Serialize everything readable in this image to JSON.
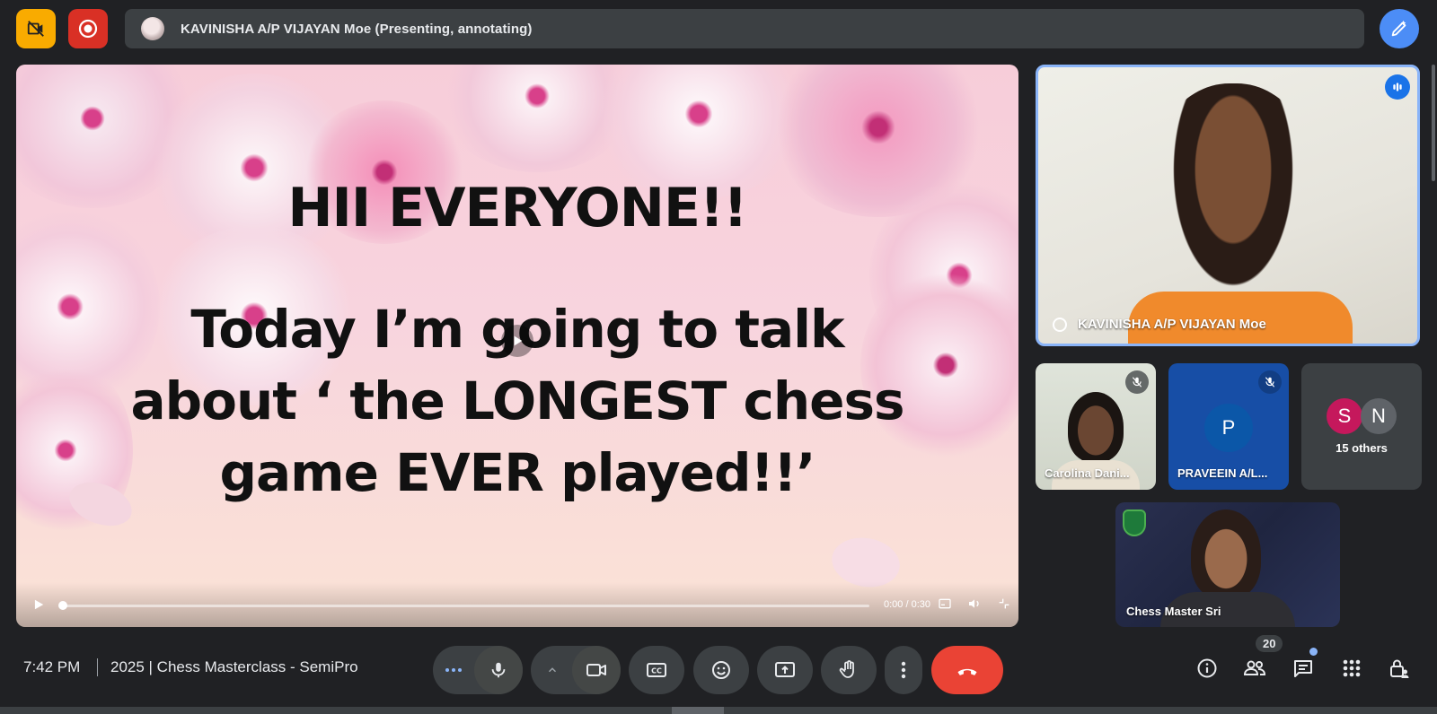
{
  "topbar": {
    "presenter_status": "KAVINISHA A/P VIJAYAN Moe (Presenting, annotating)",
    "icons": [
      "no-video-icon",
      "record-icon",
      "pen-edit-icon"
    ],
    "colors": {
      "camera_off_button": "#f9ab00",
      "record_button": "#d93025",
      "annotate_button": "#4c8df6"
    }
  },
  "slide": {
    "heading": "HII EVERYONE!!",
    "body_line1": "Today I’m going to talk",
    "body_line2": "about ‘ the LONGEST chess",
    "body_line3": "game EVER played!!’"
  },
  "video": {
    "time": "0:00 / 0:30",
    "progress": 0
  },
  "participants": {
    "main": {
      "name": "KAVINISHA A/P VIJAYAN Moe"
    },
    "carolina": {
      "name": "Carolina Dani..."
    },
    "praveein": {
      "name": "PRAVEEIN A/L...",
      "initial": "P"
    },
    "others": {
      "initial1": "S",
      "initial2": "N",
      "label": "15 others"
    },
    "sri": {
      "name": "Chess Master Sri"
    }
  },
  "bottombar": {
    "clock": "7:42 PM",
    "meeting_title": "2025 | Chess Masterclass - SemiPro",
    "participant_count": "20"
  }
}
